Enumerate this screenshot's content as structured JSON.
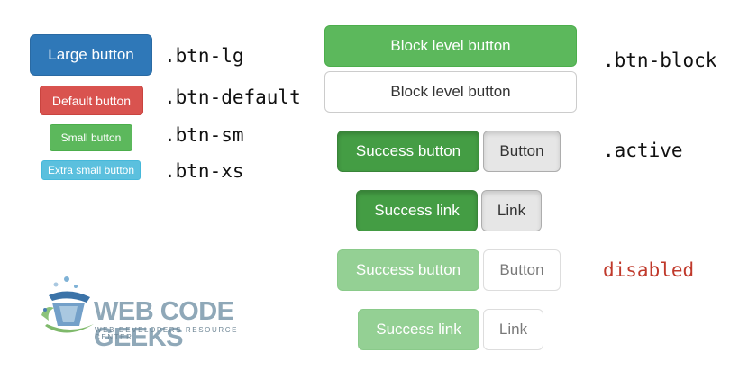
{
  "sizes": {
    "large": "Large button",
    "default": "Default button",
    "small": "Small button",
    "xsmall": "Extra small button",
    "label_lg": ".btn-lg",
    "label_default": ".btn-default",
    "label_sm": ".btn-sm",
    "label_xs": ".btn-xs"
  },
  "block": {
    "success": "Block level button",
    "default": "Block level button",
    "label": ".btn-block"
  },
  "active": {
    "success_button": "Success button",
    "button": "Button",
    "success_link": "Success link",
    "link": "Link",
    "label": ".active"
  },
  "disabled": {
    "success_button": "Success button",
    "button": "Button",
    "success_link": "Success link",
    "link": "Link",
    "label": "disabled"
  },
  "logo": {
    "name": "WEB CODE GEEKS",
    "tagline": "WEB DEVELOPERS RESOURCE CENTER"
  },
  "colors": {
    "primary": "#2f78b8",
    "danger": "#d9534f",
    "success": "#5cb85c",
    "info": "#5bc0de",
    "disabled_label": "#c0392b"
  }
}
